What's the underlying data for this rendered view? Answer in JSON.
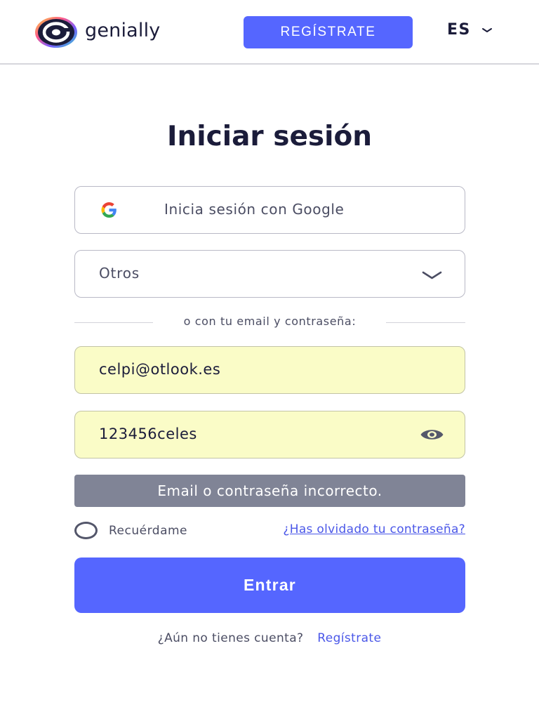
{
  "header": {
    "brand": "genially",
    "register_label": "REGÍSTRATE",
    "language": "ES"
  },
  "main": {
    "title": "Iniciar sesión",
    "google_label": "Inicia sesión con Google",
    "other_select_value": "Otros",
    "divider_text": "o con tu email y contraseña:",
    "email_value": "celpi@otlook.es",
    "password_value": "123456celes",
    "error_message": "Email o contraseña incorrecto.",
    "remember_label": "Recuérdame",
    "forgot_label": "¿Has olvidado tu contraseña?",
    "submit_label": "Entrar",
    "no_account_text": "¿Aún no tienes cuenta?",
    "signup_link": "Regístrate"
  },
  "colors": {
    "accent": "#5566ff",
    "autofill_background": "#fafcc7",
    "error_background": "#808496",
    "link": "#4a57e8",
    "text": "#1b1c3a"
  },
  "icons": {
    "logo": "genially-logo-icon",
    "google": "google-icon",
    "language_caret": "chevron-down-icon",
    "select_caret": "chevron-down-icon",
    "password_toggle": "eye-icon",
    "remember": "radio-circle-icon"
  }
}
